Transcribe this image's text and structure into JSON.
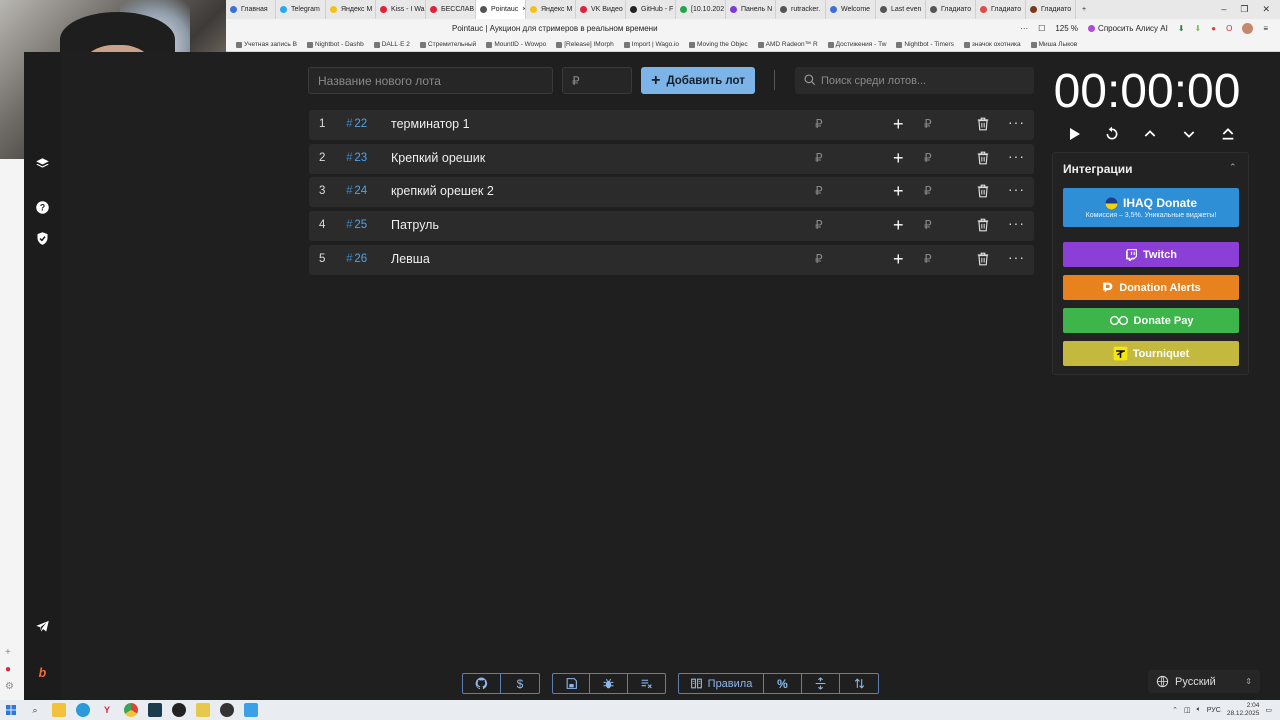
{
  "browser": {
    "tabs": [
      {
        "label": "Главная",
        "color": "#3c6fd8",
        "active": false
      },
      {
        "label": "Telegram",
        "color": "#29a8eb",
        "active": false
      },
      {
        "label": "Яндекс М",
        "color": "#f2c01d",
        "active": false
      },
      {
        "label": "Kiss - I Wa",
        "color": "#e0213a",
        "active": false
      },
      {
        "label": "БЕССЛАВ",
        "color": "#e0213a",
        "active": false
      },
      {
        "label": "Pointauc",
        "color": "#555555",
        "active": true
      },
      {
        "label": "Яндекс М",
        "color": "#f2c01d",
        "active": false
      },
      {
        "label": "VK Видео",
        "color": "#e0213a",
        "active": false
      },
      {
        "label": "GitHub - F",
        "color": "#222222",
        "active": false
      },
      {
        "label": "[10.10.202",
        "color": "#23a34a",
        "active": false
      },
      {
        "label": "Панель N",
        "color": "#7a3bd8",
        "active": false
      },
      {
        "label": "rutracker.",
        "color": "#555555",
        "active": false
      },
      {
        "label": "Welcome",
        "color": "#3c6fd8",
        "active": false
      },
      {
        "label": "Last even",
        "color": "#555555",
        "active": false
      },
      {
        "label": "Гладиато",
        "color": "#555555",
        "active": false
      },
      {
        "label": "Гладиато",
        "color": "#e04a4a",
        "active": false
      },
      {
        "label": "Гладиато",
        "color": "#7a3a1a",
        "active": false
      }
    ],
    "page_title": "Pointauc | Аукцион для стримеров в реальном времени",
    "zoom": "125 %",
    "alice_label": "Спросить Алису AI",
    "bookmarks": [
      "Учетная запись B",
      "Nightbot - Dashb",
      "DALL·E 2",
      "Стремительный",
      "MountID - Wowpo",
      "[Release] IMorph",
      "Import | Wago.io",
      "Moving the Objec",
      "AMD Radeon™ R",
      "Достижения - Tw",
      "Nightbot - Timers",
      "значок охотника",
      "Миша Лыков"
    ]
  },
  "form": {
    "name_placeholder": "Название нового лота",
    "price_placeholder": "₽",
    "add_label": "Добавить лот",
    "search_placeholder": "Поиск среди лотов..."
  },
  "lots": [
    {
      "num": "1",
      "id": "22",
      "name": "терминатор 1",
      "currency": "₽",
      "plus": "+",
      "more": "···"
    },
    {
      "num": "2",
      "id": "23",
      "name": "Крепкий орешик",
      "currency": "₽",
      "plus": "+",
      "more": "···"
    },
    {
      "num": "3",
      "id": "24",
      "name": "крепкий орешек 2",
      "currency": "₽",
      "plus": "+",
      "more": "···"
    },
    {
      "num": "4",
      "id": "25",
      "name": "Патруль",
      "currency": "₽",
      "plus": "+",
      "more": "···"
    },
    {
      "num": "5",
      "id": "26",
      "name": "Левша",
      "currency": "₽",
      "plus": "+",
      "more": "···"
    }
  ],
  "hash": "#",
  "timer": "00:00:00",
  "integrations": {
    "title": "Интеграции",
    "ihaq_label": "IHAQ Donate",
    "ihaq_sub": "Комиссия – 3,5%. Уникальные виджеты!",
    "twitch_label": "Twitch",
    "donation_alerts_label": "Donation Alerts",
    "donate_pay_label": "Donate Pay",
    "tourniquet_label": "Tourniquet",
    "colors": {
      "ihaq": "#2e8ed6",
      "twitch": "#8c3fd6",
      "donation_alerts": "#e8821e",
      "donate_pay": "#3db54a",
      "tourniquet": "#c3b93e"
    }
  },
  "toolbar": {
    "rules_label": "Правила",
    "percent_label": "%"
  },
  "language": "Русский",
  "taskbar": {
    "lang": "РУС",
    "time": "2:04",
    "date": "28.12.2025"
  }
}
